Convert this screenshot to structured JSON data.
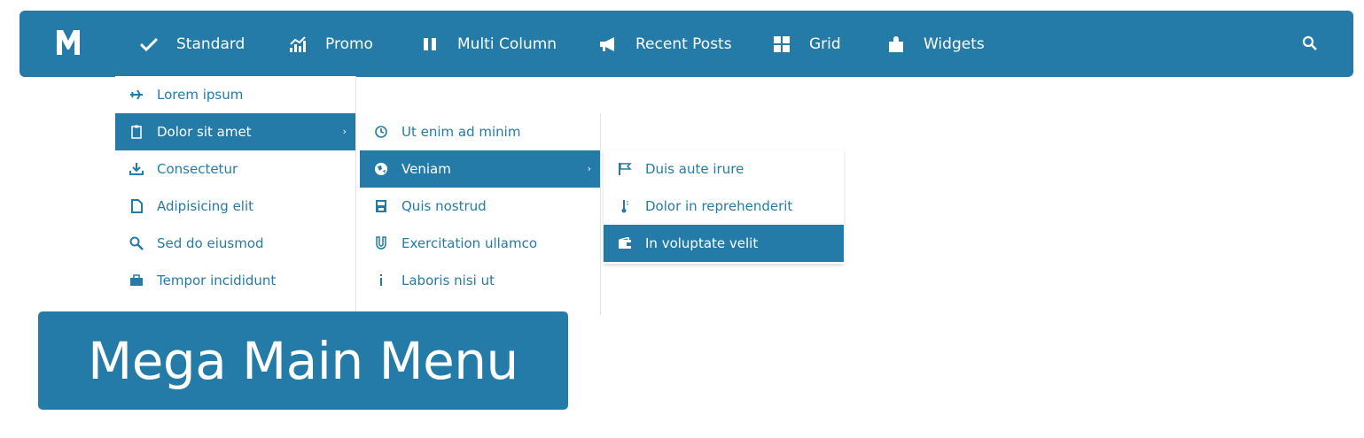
{
  "nav": {
    "items": [
      {
        "label": "Standard",
        "icon": "checkmark-icon"
      },
      {
        "label": "Promo",
        "icon": "chart-icon"
      },
      {
        "label": "Multi Column",
        "icon": "columns-icon"
      },
      {
        "label": "Recent Posts",
        "icon": "megaphone-icon"
      },
      {
        "label": "Grid",
        "icon": "grid-icon"
      },
      {
        "label": "Widgets",
        "icon": "puzzle-icon"
      }
    ],
    "search_icon": "search-icon",
    "logo_icon": "m-logo-icon"
  },
  "menu1": {
    "items": [
      {
        "label": "Lorem ipsum",
        "icon": "plane-icon"
      },
      {
        "label": "Dolor sit amet",
        "icon": "clipboard-icon"
      },
      {
        "label": "Consectetur",
        "icon": "download-icon"
      },
      {
        "label": "Adipisicing elit",
        "icon": "document-icon"
      },
      {
        "label": "Sed do eiusmod",
        "icon": "zoom-icon"
      },
      {
        "label": "Tempor incididunt",
        "icon": "briefcase-icon"
      }
    ]
  },
  "menu2": {
    "items": [
      {
        "label": "Ut enim ad minim",
        "icon": "history-icon"
      },
      {
        "label": "Veniam",
        "icon": "globe-icon"
      },
      {
        "label": "Quis nostrud",
        "icon": "save-icon"
      },
      {
        "label": "Exercitation ullamco",
        "icon": "magnet-icon"
      },
      {
        "label": "Laboris nisi ut",
        "icon": "info-icon"
      }
    ]
  },
  "menu3": {
    "items": [
      {
        "label": "Duis aute irure",
        "icon": "flag-icon"
      },
      {
        "label": "Dolor in reprehenderit",
        "icon": "thermometer-icon"
      },
      {
        "label": "In voluptate velit",
        "icon": "wallet-icon"
      }
    ]
  },
  "badge": {
    "text": "Mega Main Menu"
  },
  "colors": {
    "accent": "#247ba7",
    "background": "#ffffff"
  }
}
